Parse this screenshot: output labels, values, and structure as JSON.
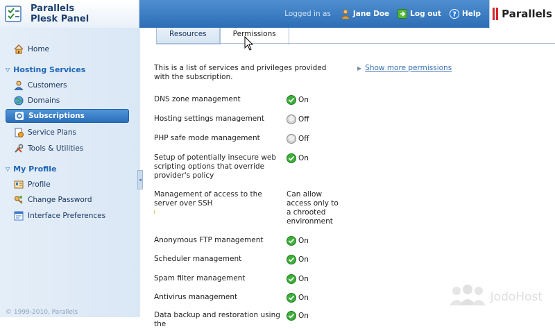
{
  "app": {
    "logo_line1": "Parallels",
    "logo_line2": "Plesk Panel",
    "brand": "Parallels"
  },
  "header": {
    "logged_in_as": "Logged in as",
    "user_name": "Jane Doe",
    "logout_label": "Log out",
    "help_label": "Help"
  },
  "sidebar": {
    "home": "Home",
    "hosting_section": "Hosting Services",
    "hosting_items": [
      {
        "label": "Customers",
        "icon": "customers-icon"
      },
      {
        "label": "Domains",
        "icon": "domains-icon"
      },
      {
        "label": "Subscriptions",
        "icon": "subscriptions-icon",
        "active": true
      },
      {
        "label": "Service Plans",
        "icon": "service-plans-icon"
      },
      {
        "label": "Tools & Utilities",
        "icon": "tools-icon"
      }
    ],
    "profile_section": "My Profile",
    "profile_items": [
      {
        "label": "Profile",
        "icon": "profile-icon"
      },
      {
        "label": "Change Password",
        "icon": "key-icon"
      },
      {
        "label": "Interface Preferences",
        "icon": "preferences-icon"
      }
    ],
    "copyright": "© 1999-2010, Parallels"
  },
  "tabs": [
    {
      "label": "Resources",
      "active": false
    },
    {
      "label": "Permissions",
      "active": true
    }
  ],
  "intro_text": "This is a list of services and privileges provided with the subscription.",
  "show_more_link": "Show more permissions",
  "permissions": [
    {
      "label": "DNS zone management",
      "value": "On",
      "state": "on"
    },
    {
      "label": "Hosting settings management",
      "value": "Off",
      "state": "off"
    },
    {
      "label": "PHP safe mode management",
      "value": "Off",
      "state": "off"
    },
    {
      "label": "Setup of potentially insecure web scripting options that override provider's policy",
      "value": "On",
      "state": "on"
    },
    {
      "label": "Management of access to the server over SSH",
      "value": "Can allow access only to a chrooted environment",
      "state": "text"
    },
    {
      "label": "Anonymous FTP management",
      "value": "On",
      "state": "on"
    },
    {
      "label": "Scheduler management",
      "value": "On",
      "state": "on"
    },
    {
      "label": "Spam filter management",
      "value": "On",
      "state": "on"
    },
    {
      "label": "Antivirus management",
      "value": "On",
      "state": "on"
    },
    {
      "label": "Data backup and restoration using the",
      "value": "On",
      "state": "on"
    }
  ],
  "watermark": "JodoHost",
  "colors": {
    "header_blue": "#2c6db5",
    "sidebar_bg": "#dae7f5",
    "active_item": "#2a6fba",
    "section_title": "#1e65b5",
    "on_green": "#3db03a",
    "off_gray": "#cccccc"
  }
}
